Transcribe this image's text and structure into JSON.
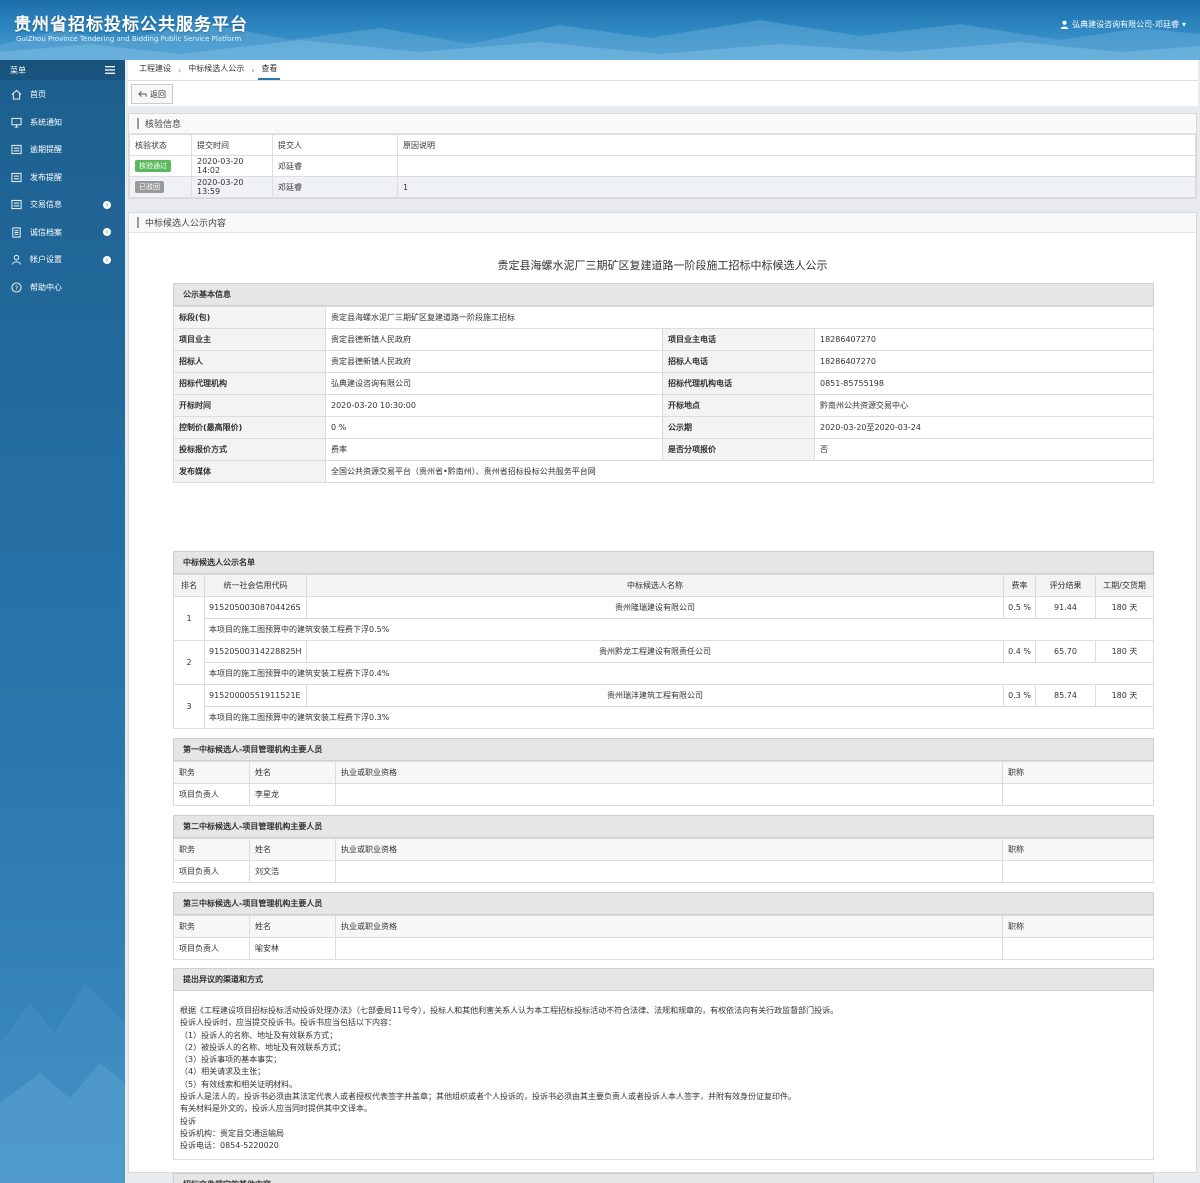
{
  "header": {
    "title": "贵州省招标投标公共服务平台",
    "subtitle": "GuiZhou Province Tendering and Bidding Public Service Platform",
    "user": "弘典建设咨询有限公司-邓廷睿",
    "caret": "▾"
  },
  "sidebar": {
    "label": "菜单",
    "items": [
      {
        "label": "首页"
      },
      {
        "label": "系统通知"
      },
      {
        "label": "逾期提醒"
      },
      {
        "label": "发布提醒"
      },
      {
        "label": "交易信息"
      },
      {
        "label": "诚信档案"
      },
      {
        "label": "帐户设置"
      },
      {
        "label": "帮助中心"
      }
    ]
  },
  "breadcrumb": [
    "工程建设",
    "中标候选人公示",
    "查看"
  ],
  "toolbar": {
    "back_label": "返回"
  },
  "check": {
    "title": "核验信息",
    "headers": [
      "核验状态",
      "提交时间",
      "提交人",
      "原因说明"
    ],
    "rows": [
      {
        "status": "核验通过",
        "status_color": "#5cb85c",
        "time": "2020-03-20 14:02",
        "person": "邓廷睿",
        "reason": ""
      },
      {
        "status": "已驳回",
        "status_color": "#999999",
        "time": "2020-03-20 13:59",
        "person": "邓廷睿",
        "reason": "1"
      }
    ]
  },
  "content": {
    "panel_title": "中标候选人公示内容",
    "notice_title": "贵定县海螺水泥厂三期矿区复建道路一阶段施工招标中标候选人公示",
    "basic": {
      "title": "公示基本信息",
      "section_label": "标段(包)",
      "section_value": "贵定县海螺水泥厂三期矿区复建道路一阶段施工招标",
      "owner_label": "项目业主",
      "owner_value": "贵定县德新镇人民政府",
      "owner_tel_label": "项目业主电话",
      "owner_tel_value": "18286407270",
      "tenderer_label": "招标人",
      "tenderer_value": "贵定县德新镇人民政府",
      "tenderer_tel_label": "招标人电话",
      "tenderer_tel_value": "18286407270",
      "agency_label": "招标代理机构",
      "agency_value": "弘典建设咨询有限公司",
      "agency_tel_label": "招标代理机构电话",
      "agency_tel_value": "0851-85755198",
      "open_time_label": "开标时间",
      "open_time_value": "2020-03-20 10:30:00",
      "open_place_label": "开标地点",
      "open_place_value": "黔南州公共资源交易中心",
      "control_label": "控制价(最高限价)",
      "control_value": "0 %",
      "period_label": "公示期",
      "period_value": "2020-03-20至2020-03-24",
      "method_label": "投标报价方式",
      "method_value": "费率",
      "split_label": "是否分项报价",
      "split_value": "否",
      "media_label": "发布媒体",
      "media_value": "全国公共资源交易平台（贵州省•黔南州）、贵州省招标投标公共服务平台网"
    },
    "candidates": {
      "title": "中标候选人公示名单",
      "headers": [
        "排名",
        "统一社会信用代码",
        "中标候选人名称",
        "费率",
        "评分结果",
        "工期/交货期"
      ],
      "rows": [
        {
          "rank": "1",
          "code": "91520500308704426S",
          "name": "贵州隆瑞建设有限公司",
          "rate": "0.5 %",
          "score": "91.44",
          "period": "180 天",
          "note": "本项目的施工图预算中的建筑安装工程费下浮0.5%"
        },
        {
          "rank": "2",
          "code": "91520500314228825H",
          "name": "贵州黔龙工程建设有限责任公司",
          "rate": "0.4 %",
          "score": "65.70",
          "period": "180 天",
          "note": "本项目的施工图预算中的建筑安装工程费下浮0.4%"
        },
        {
          "rank": "3",
          "code": "91520000551911521E",
          "name": "贵州瑞沣建筑工程有限公司",
          "rate": "0.3 %",
          "score": "85.74",
          "period": "180 天",
          "note": "本项目的施工图预算中的建筑安装工程费下浮0.3%"
        }
      ]
    },
    "personnel_headers": [
      "职务",
      "姓名",
      "执业或职业资格",
      "职称"
    ],
    "personnel": [
      {
        "title": "第一中标候选人-项目管理机构主要人员",
        "role": "项目负责人",
        "name": "李星龙",
        "qual": "",
        "rank": ""
      },
      {
        "title": "第二中标候选人-项目管理机构主要人员",
        "role": "项目负责人",
        "name": "刘文浩",
        "qual": "",
        "rank": ""
      },
      {
        "title": "第三中标候选人-项目管理机构主要人员",
        "role": "项目负责人",
        "name": "喻安林",
        "qual": "",
        "rank": ""
      }
    ],
    "objection": {
      "title": "提出异议的渠道和方式",
      "lines": [
        "根据《工程建设项目招标投标活动投诉处理办法》（七部委局11号令），投标人和其他利害关系人认为本工程招标投标活动不符合法律、法规和规章的，有权依法向有关行政监督部门投诉。",
        "投诉人投诉时，应当提交投诉书。投诉书应当包括以下内容：",
        "（1）投诉人的名称、地址及有效联系方式；",
        "（2）被投诉人的名称、地址及有效联系方式；",
        "（3）投诉事项的基本事实；",
        "（4）相关请求及主张；",
        "（5）有效线索和相关证明材料。",
        "投诉人是法人的，投诉书必须由其法定代表人或者授权代表签字并盖章；其他组织或者个人投诉的，投诉书必须由其主要负责人或者投诉人本人签字，并附有效身份证复印件。",
        "有关材料是外文的，投诉人应当同时提供其中文译本。",
        "投诉",
        "投诉机构：贵定县交通运输局",
        "投诉电话：0854-5220020"
      ]
    },
    "other": {
      "title": "招标文件规定的其他内容",
      "value": "/"
    }
  }
}
